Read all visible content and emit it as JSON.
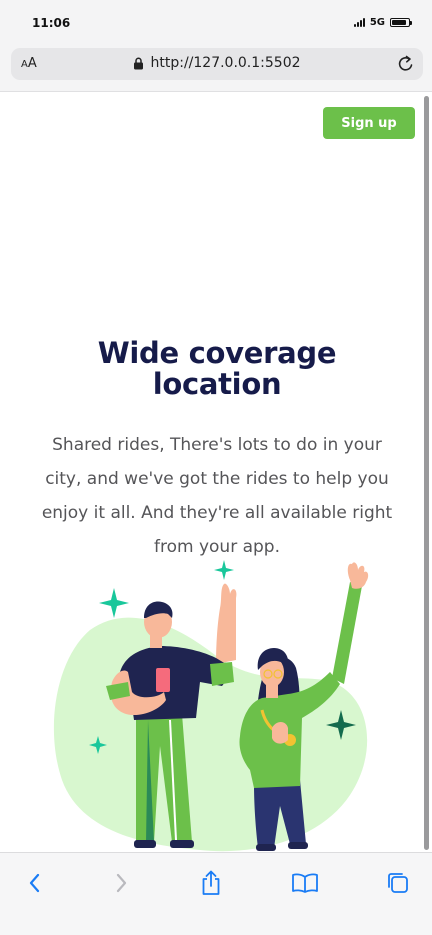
{
  "status_bar": {
    "time": "11:06",
    "network": "5G",
    "battery_level": 0.9
  },
  "browser": {
    "text_size_label_small": "A",
    "text_size_label_large": "A",
    "url": "http://127.0.0.1:5502"
  },
  "header": {
    "signup_label": "Sign up"
  },
  "hero": {
    "title_line1": "Wide coverage",
    "title_line2": "location",
    "description": "Shared rides, There's lots to do in your city, and we've got the rides to help you enjoy it all. And they're all available right from your app."
  },
  "colors": {
    "accent": "#6cc04a",
    "title": "#161b4a",
    "body_text": "#555558",
    "ios_blue": "#1a7cf5"
  },
  "icons": {
    "lock": "lock-icon",
    "reload": "reload-icon",
    "back": "chevron-left-icon",
    "forward": "chevron-right-icon",
    "share": "share-icon",
    "bookmarks": "book-icon",
    "tabs": "tabs-icon"
  }
}
